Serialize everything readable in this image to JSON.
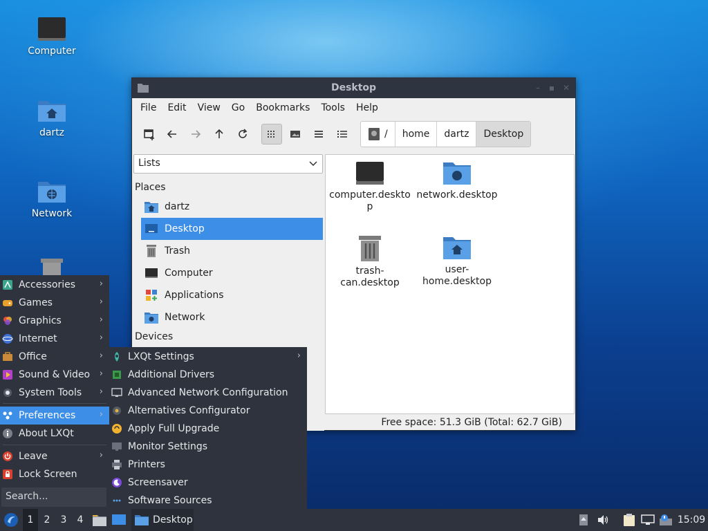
{
  "desktop": {
    "icons": [
      {
        "label": "Computer"
      },
      {
        "label": "dartz"
      },
      {
        "label": "Network"
      }
    ]
  },
  "window": {
    "title": "Desktop",
    "menu": [
      "File",
      "Edit",
      "View",
      "Go",
      "Bookmarks",
      "Tools",
      "Help"
    ],
    "breadcrumbs": [
      "/",
      "home",
      "dartz",
      "Desktop"
    ],
    "side_select": "Lists",
    "places_header": "Places",
    "places": [
      "dartz",
      "Desktop",
      "Trash",
      "Computer",
      "Applications",
      "Network"
    ],
    "devices_header": "Devices",
    "files": [
      {
        "name": "computer.deskto\np"
      },
      {
        "name": "network.desktop"
      },
      {
        "name": "trash-\ncan.desktop"
      },
      {
        "name": "user-\nhome.desktop"
      }
    ],
    "status": "Free space: 51.3 GiB (Total: 62.7 GiB)"
  },
  "app_menu": {
    "items": [
      "Accessories",
      "Games",
      "Graphics",
      "Internet",
      "Office",
      "Sound & Video",
      "System Tools",
      "Preferences",
      "About LXQt",
      "Leave",
      "Lock Screen"
    ],
    "search_placeholder": "Search..."
  },
  "preferences_submenu": {
    "items": [
      "LXQt Settings",
      "Additional Drivers",
      "Advanced Network Configuration",
      "Alternatives Configurator",
      "Apply Full Upgrade",
      "Monitor Settings",
      "Printers",
      "Screensaver",
      "Software Sources"
    ]
  },
  "taskbar": {
    "workspaces": [
      "1",
      "2",
      "3",
      "4"
    ],
    "active_task": "Desktop",
    "clock": "15:09"
  },
  "colors": {
    "accent": "#3d8ee6",
    "panel": "#2f333d",
    "titlebar": "#2f3441",
    "folder": "#4a90d9"
  }
}
